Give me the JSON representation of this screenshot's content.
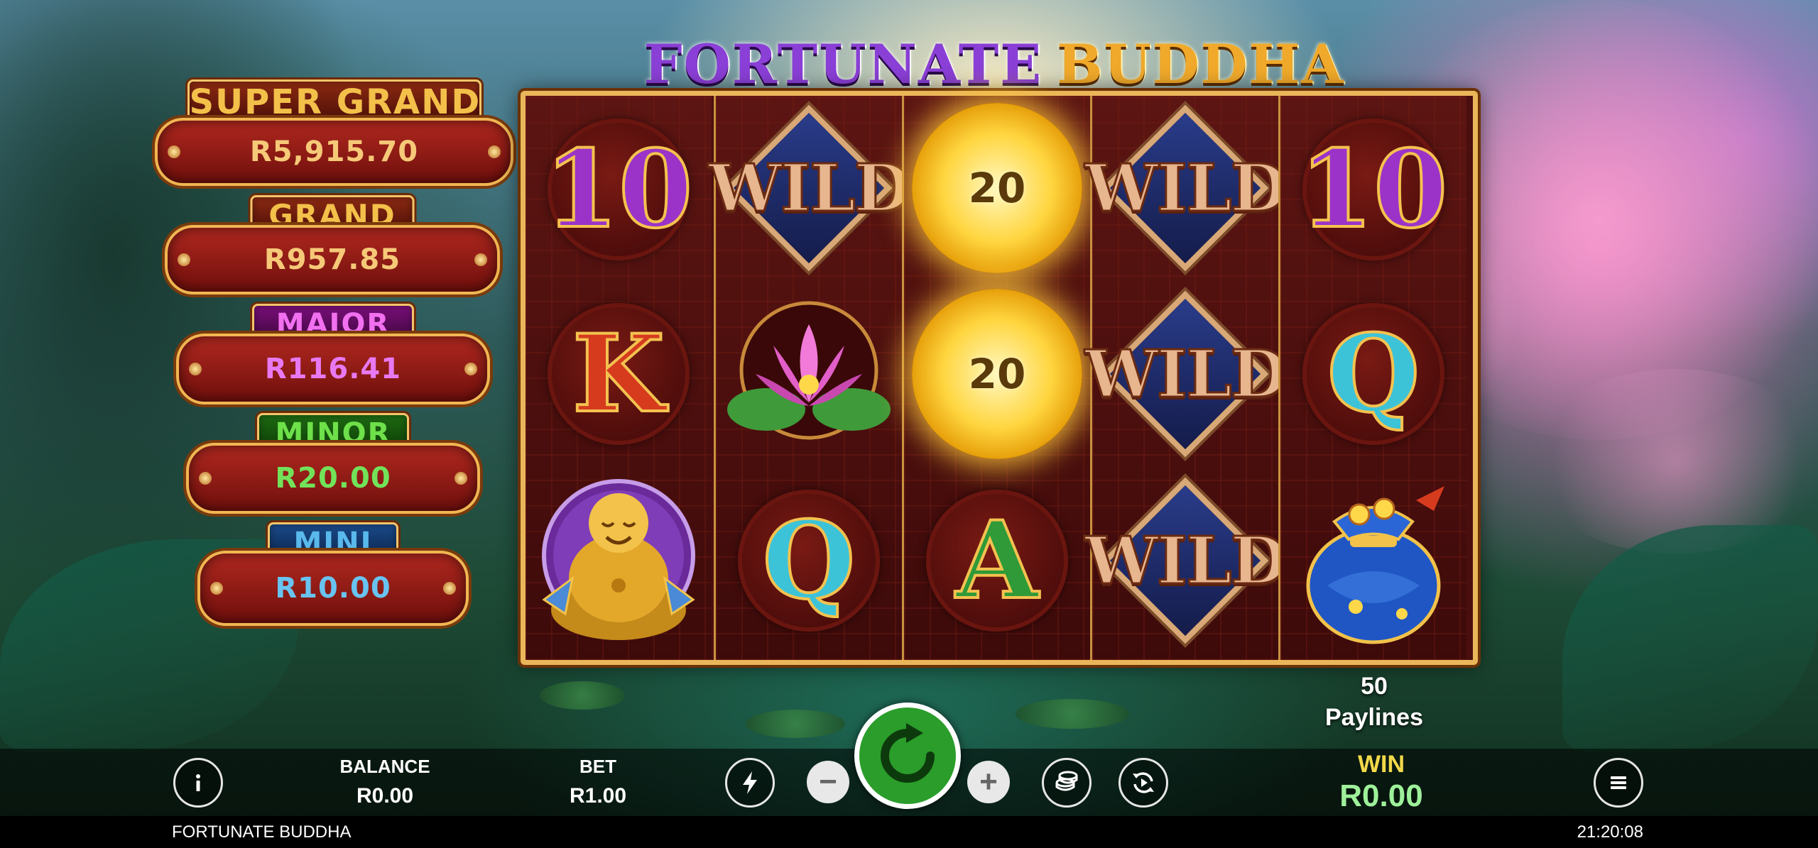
{
  "game": {
    "title_part1": "FORTUNATE",
    "title_part2": "BUDDHA"
  },
  "jackpots": [
    {
      "label": "SUPER GRAND",
      "value": "R5,915.70",
      "label_color": "#f3c04a",
      "value_color": "#f6c978"
    },
    {
      "label": "GRAND",
      "value": "R957.85",
      "label_color": "#f3c04a",
      "value_color": "#f6c978"
    },
    {
      "label": "MAJOR",
      "value": "R116.41",
      "label_color": "#f070f0",
      "value_color": "#e879f2"
    },
    {
      "label": "MINOR",
      "value": "R20.00",
      "label_color": "#6ee04a",
      "value_color": "#72e25a"
    },
    {
      "label": "MINI",
      "value": "R10.00",
      "label_color": "#5ab9ec",
      "value_color": "#69c3f0"
    }
  ],
  "reels": {
    "symbols": [
      [
        "ten-purple",
        "king-red",
        "buddha"
      ],
      [
        "wild",
        "lotus",
        "queen-cyan"
      ],
      [
        "sun-coin",
        "sun-coin",
        "ace-green"
      ],
      [
        "wild",
        "wild",
        "wild"
      ],
      [
        "ten-purple",
        "queen-cyan",
        "money-bag"
      ]
    ],
    "ten_label": "10",
    "king_label": "K",
    "queen_label": "Q",
    "ace_label": "A",
    "wild_label": "WILD",
    "coin_values": [
      "20",
      "20"
    ]
  },
  "paylines": {
    "count": "50",
    "label": "Paylines"
  },
  "controls": {
    "info_icon": "info-icon",
    "balance_label": "BALANCE",
    "balance_value": "R0.00",
    "bet_label": "BET",
    "bet_value": "R1.00",
    "minus_label": "−",
    "plus_label": "+",
    "win_label": "WIN",
    "win_value": "R0.00",
    "win_label_color": "#f2d84a",
    "win_value_color": "#9ef09a"
  },
  "footer": {
    "title": "FORTUNATE BUDDHA",
    "clock": "21:20:08"
  }
}
